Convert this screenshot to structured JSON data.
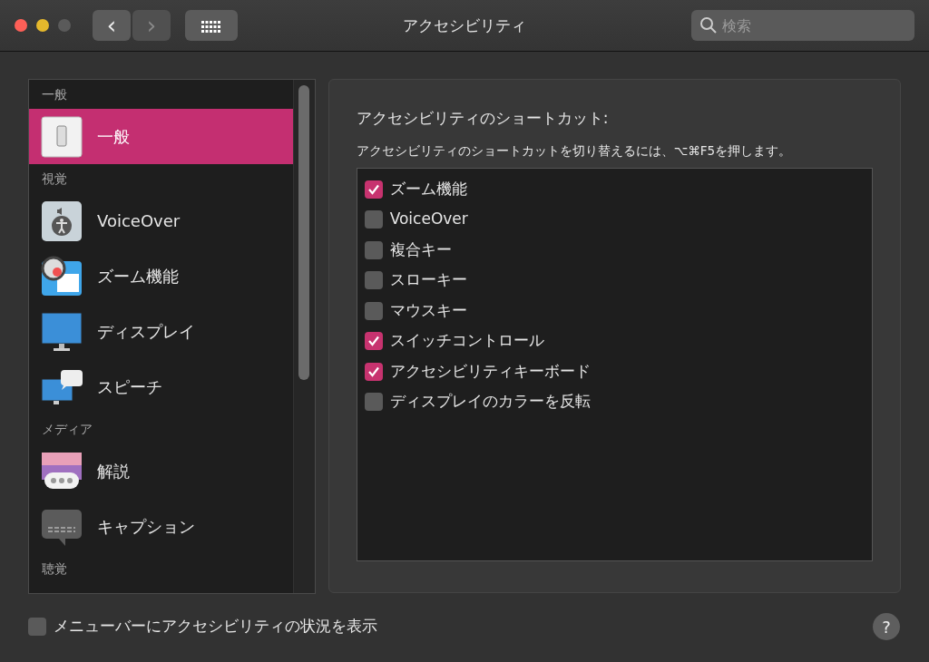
{
  "window": {
    "title": "アクセシビリティ"
  },
  "toolbar": {
    "back": {
      "label": "‹",
      "disabled": false
    },
    "forward": {
      "label": "›",
      "disabled": true
    },
    "search": {
      "placeholder": "検索"
    }
  },
  "sidebar": {
    "items": [
      {
        "kind": "header",
        "label": "一般"
      },
      {
        "kind": "item",
        "label": "一般",
        "selected": true
      },
      {
        "kind": "header",
        "label": "視覚"
      },
      {
        "kind": "item",
        "label": "VoiceOver",
        "selected": false
      },
      {
        "kind": "item",
        "label": "ズーム機能",
        "selected": false
      },
      {
        "kind": "item",
        "label": "ディスプレイ",
        "selected": false
      },
      {
        "kind": "item",
        "label": "スピーチ",
        "selected": false
      },
      {
        "kind": "header",
        "label": "メディア"
      },
      {
        "kind": "item",
        "label": "解説",
        "selected": false
      },
      {
        "kind": "item",
        "label": "キャプション",
        "selected": false
      },
      {
        "kind": "header",
        "label": "聴覚"
      }
    ]
  },
  "panel": {
    "heading": "アクセシビリティのショートカット:",
    "hint": "アクセシビリティのショートカットを切り替えるには、⌥⌘F5を押します。",
    "shortcuts": [
      {
        "label": "ズーム機能",
        "checked": true
      },
      {
        "label": "VoiceOver",
        "checked": false
      },
      {
        "label": "複合キー",
        "checked": false
      },
      {
        "label": "スローキー",
        "checked": false
      },
      {
        "label": "マウスキー",
        "checked": false
      },
      {
        "label": "スイッチコントロール",
        "checked": true
      },
      {
        "label": "アクセシビリティキーボード",
        "checked": true
      },
      {
        "label": "ディスプレイのカラーを反転",
        "checked": false
      }
    ]
  },
  "footer": {
    "status_option": {
      "label": "メニューバーにアクセシビリティの状況を表示",
      "checked": false
    },
    "help": "?"
  }
}
